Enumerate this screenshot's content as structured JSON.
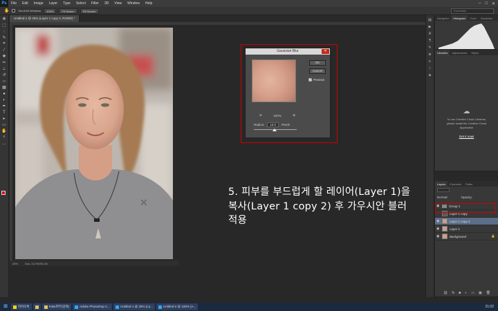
{
  "menu": [
    "File",
    "Edit",
    "Image",
    "Layer",
    "Type",
    "Select",
    "Filter",
    "3D",
    "View",
    "Window",
    "Help"
  ],
  "app_logo": "Ps",
  "options": {
    "scroll_all": "Scroll All Windows",
    "btn1": "100%",
    "btn2": "Fit Screen",
    "btn3": "Fill Screen",
    "workspace": "Essentials"
  },
  "doc": {
    "tab1": "Untitled-1 @ 25% (Layer 1 copy 2, RGB/8) *",
    "status_zoom": "25%",
    "status_doc": "Doc: 24.7M/35.1M"
  },
  "dialog": {
    "title": "Gaussian Blur",
    "ok": "OK",
    "cancel": "Cancel",
    "preview": "Preview",
    "zoom": "100%",
    "radius_label": "Radius:",
    "radius_value": "10.0",
    "unit": "Pixels"
  },
  "panels": {
    "top_tabs": [
      "Navigator",
      "Histogram",
      "Color",
      "Swatches"
    ],
    "lib_tabs": [
      "Libraries",
      "Adjustments",
      "Styles"
    ],
    "cc_msg": "To use Creative Cloud Libraries, please install the Creative Cloud Application",
    "cc_link": "Get it now!",
    "layer_tabs": [
      "Layers",
      "Channels",
      "Paths"
    ],
    "blend": "Normal",
    "opacity": "Opacity:",
    "layers": [
      {
        "name": "Group 1"
      },
      {
        "name": "Layer 1 copy"
      },
      {
        "name": "Layer 1 copy 2"
      },
      {
        "name": "Layer 1"
      },
      {
        "name": "Background"
      }
    ]
  },
  "caption": {
    "line1": "5. 피부를 부드럽게 할 레이어(Layer 1)을",
    "line2": "복사(Layer 1 copy 2) 후 가우시안 블러",
    "line3": "적용"
  },
  "taskbar": {
    "items": [
      "카카오톡",
      "",
      "Fake피부(강좌)",
      "Adobe Photoshop C...",
      "Untitled-1 @ 25% (La...",
      "Untitled-2 @ 100% (A..."
    ],
    "time": "21:02"
  },
  "colors": {
    "accent": "#d10000",
    "selection": "#5c6e88",
    "fg_swatch": "#e00000"
  }
}
